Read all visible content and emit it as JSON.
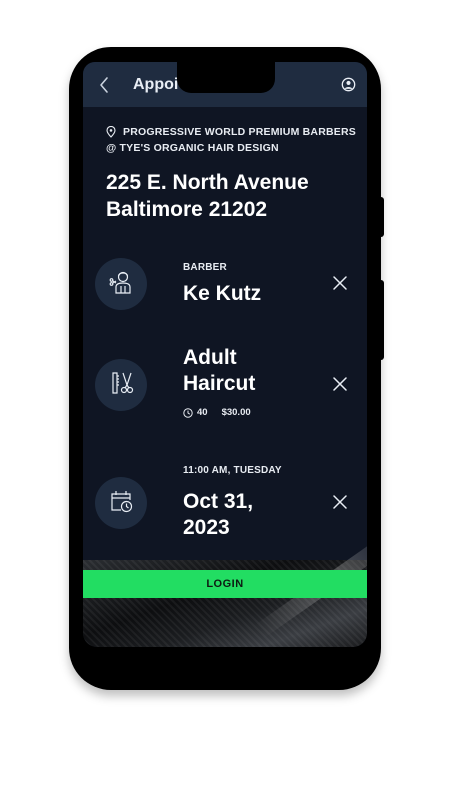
{
  "header": {
    "title": "Appoi",
    "back_icon": "chevron-left-icon",
    "user_icon": "user-circle-icon"
  },
  "location": {
    "shop_line1": "PROGRESSIVE WORLD PREMIUM BARBERS",
    "shop_line2": "@ TYE'S ORGANIC HAIR DESIGN",
    "address_line1": "225 E. North Avenue",
    "address_line2": "Baltimore 21202"
  },
  "barber": {
    "label": "BARBER",
    "name": "Ke Kutz",
    "icon": "barber-icon"
  },
  "service": {
    "name_line1": "Adult",
    "name_line2": "Haircut",
    "duration": "40",
    "price": "$30.00",
    "icon": "comb-scissors-icon"
  },
  "datetime": {
    "time_day": "11:00 AM,  TUESDAY",
    "date_line1": "Oct 31,",
    "date_line2": "2023",
    "icon": "calendar-clock-icon"
  },
  "actions": {
    "login_label": "LOGIN"
  },
  "colors": {
    "background": "#0f1523",
    "header": "#1f2c40",
    "accent_green": "#22dd62"
  }
}
